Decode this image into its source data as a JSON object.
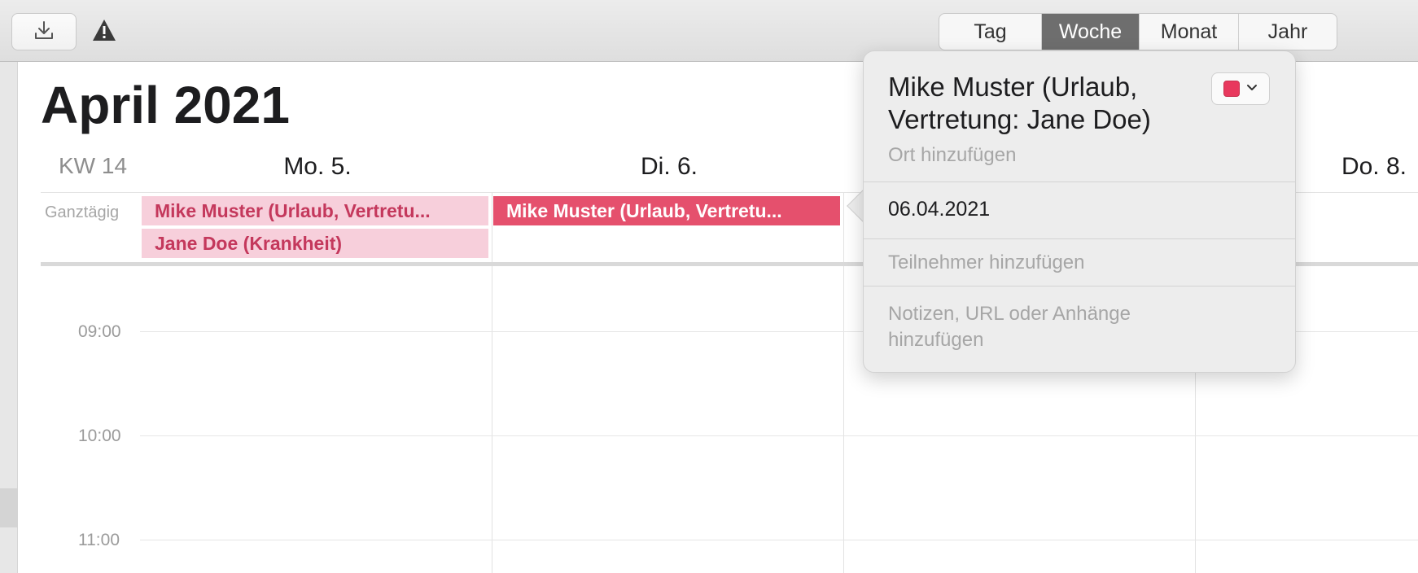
{
  "toolbar": {
    "download_icon": "download-icon",
    "warning_icon": "warning-icon",
    "views": [
      {
        "label": "Tag",
        "active": false
      },
      {
        "label": "Woche",
        "active": true
      },
      {
        "label": "Monat",
        "active": false
      },
      {
        "label": "Jahr",
        "active": false
      }
    ]
  },
  "calendar": {
    "month_title": "April 2021",
    "week_label": "KW 14",
    "days": [
      {
        "label": "Mo. 5."
      },
      {
        "label": "Di. 6."
      },
      {
        "label": "Do. 8."
      }
    ],
    "allday_label": "Ganztägig",
    "events": [
      {
        "title": "Mike Muster (Urlaub, Vertretu...",
        "style": "light"
      },
      {
        "title": "Jane Doe (Krankheit)",
        "style": "light"
      },
      {
        "title": "Mike Muster (Urlaub, Vertretu...",
        "style": "selected"
      }
    ],
    "times": [
      "09:00",
      "10:00",
      "11:00"
    ]
  },
  "popover": {
    "title": "Mike Muster (Urlaub, Vertretung: Jane Doe)",
    "location_placeholder": "Ort hinzufügen",
    "date": "06.04.2021",
    "participants_placeholder": "Teilnehmer hinzufügen",
    "notes_placeholder": "Notizen, URL oder Anhänge hinzufügen",
    "color": "#e8385d"
  },
  "colors": {
    "accent": "#e5506d",
    "event_light_bg": "#f7cfdb",
    "event_light_text": "#c4385c",
    "segment_active": "#6e6e6e"
  }
}
